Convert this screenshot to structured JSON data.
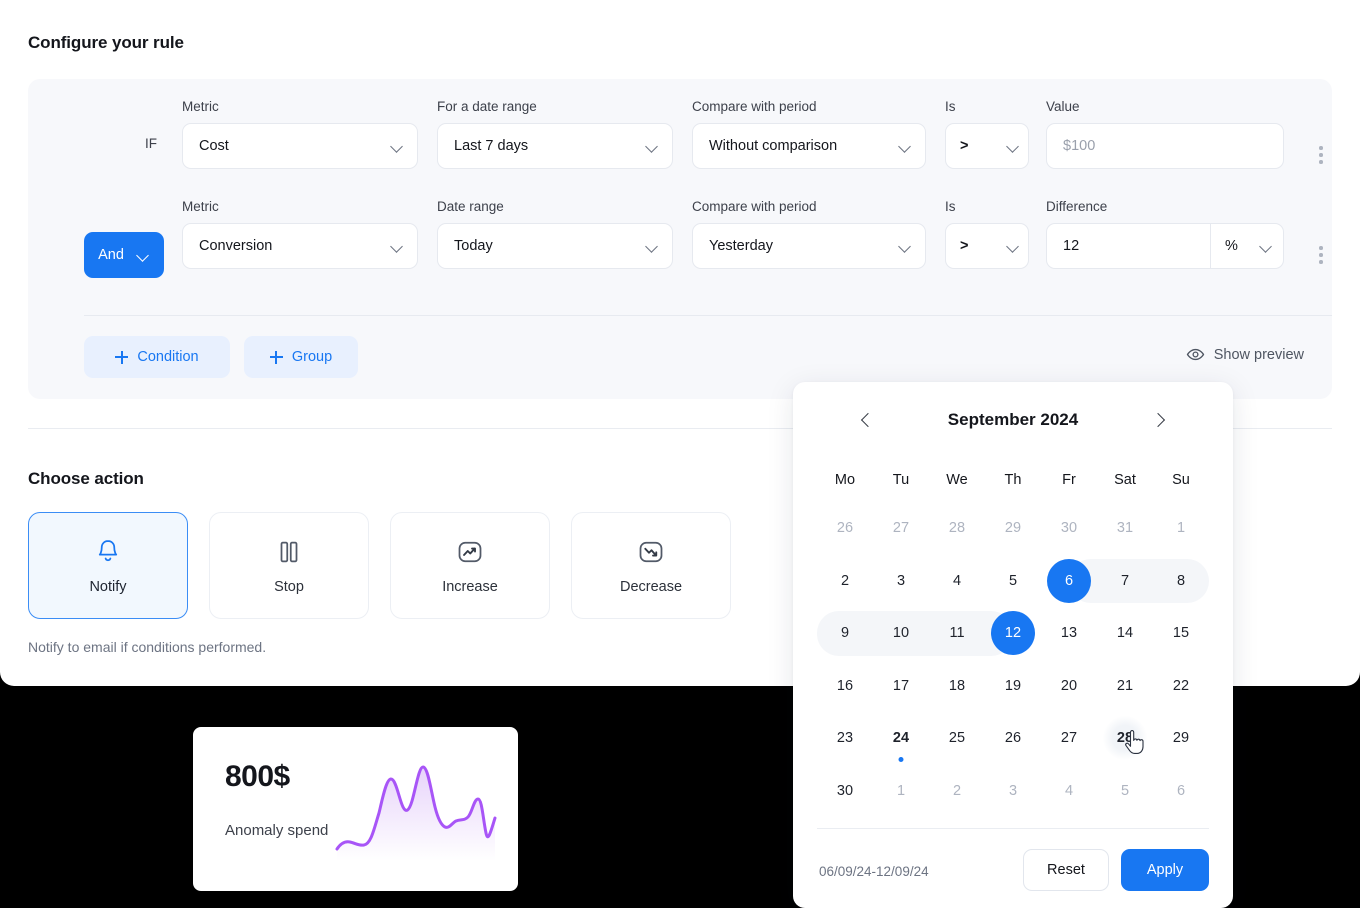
{
  "rule": {
    "title": "Configure your rule",
    "if_label": "IF",
    "and_label": "And",
    "row1": {
      "metric_label": "Metric",
      "metric_value": "Cost",
      "daterange_label": "For a date range",
      "daterange_value": "Last 7 days",
      "compare_label": "Compare with period",
      "compare_value": "Without comparison",
      "is_label": "Is",
      "is_value": ">",
      "value_label": "Value",
      "value_placeholder": "$100"
    },
    "row2": {
      "metric_label": "Metric",
      "metric_value": "Conversion",
      "daterange_label": "Date range",
      "daterange_value": "Today",
      "compare_label": "Compare with period",
      "compare_value": "Yesterday",
      "is_label": "Is",
      "is_value": ">",
      "value_label": "Difference",
      "value_value": "12",
      "unit_value": "%"
    },
    "add_condition": "Condition",
    "add_group": "Group",
    "show_preview": "Show preview"
  },
  "action": {
    "title": "Choose action",
    "cards": [
      {
        "label": "Notify",
        "icon": "bell-icon",
        "selected": true
      },
      {
        "label": "Stop",
        "icon": "pause-icon",
        "selected": false
      },
      {
        "label": "Increase",
        "icon": "trending-up-icon",
        "selected": false
      },
      {
        "label": "Decrease",
        "icon": "trending-down-icon",
        "selected": false
      }
    ],
    "description": "Notify to email if conditions performed."
  },
  "anomaly": {
    "amount": "800$",
    "label": "Anomaly spend",
    "line_color": "#9b4ee0"
  },
  "calendar": {
    "month": "September 2024",
    "weekdays": [
      "Mo",
      "Tu",
      "We",
      "Th",
      "Fr",
      "Sat",
      "Su"
    ],
    "range_text": "06/09/24-12/09/24",
    "reset_label": "Reset",
    "apply_label": "Apply",
    "accent": "#1877f2",
    "weeks": [
      [
        {
          "d": "26",
          "muted": true
        },
        {
          "d": "27",
          "muted": true
        },
        {
          "d": "28",
          "muted": true
        },
        {
          "d": "29",
          "muted": true
        },
        {
          "d": "30",
          "muted": true
        },
        {
          "d": "31",
          "muted": true
        },
        {
          "d": "1",
          "muted": true
        }
      ],
      [
        {
          "d": "2"
        },
        {
          "d": "3"
        },
        {
          "d": "4"
        },
        {
          "d": "5"
        },
        {
          "d": "6",
          "selected": true,
          "rangeStart": true
        },
        {
          "d": "7",
          "inrange": true
        },
        {
          "d": "8",
          "inrange": true,
          "rowend": true
        }
      ],
      [
        {
          "d": "9",
          "inrange": true,
          "rowstart": true
        },
        {
          "d": "10",
          "inrange": true
        },
        {
          "d": "11",
          "inrange": true
        },
        {
          "d": "12",
          "selected": true,
          "rangeEnd": true
        },
        {
          "d": "13"
        },
        {
          "d": "14"
        },
        {
          "d": "15"
        }
      ],
      [
        {
          "d": "16"
        },
        {
          "d": "17"
        },
        {
          "d": "18"
        },
        {
          "d": "19"
        },
        {
          "d": "20"
        },
        {
          "d": "21"
        },
        {
          "d": "22"
        }
      ],
      [
        {
          "d": "23"
        },
        {
          "d": "24",
          "today": true,
          "dot": true
        },
        {
          "d": "25"
        },
        {
          "d": "26"
        },
        {
          "d": "27"
        },
        {
          "d": "28",
          "hovered": true,
          "cursor": true
        },
        {
          "d": "29"
        }
      ],
      [
        {
          "d": "30"
        },
        {
          "d": "1",
          "muted": true
        },
        {
          "d": "2",
          "muted": true
        },
        {
          "d": "3",
          "muted": true
        },
        {
          "d": "4",
          "muted": true
        },
        {
          "d": "5",
          "muted": true
        },
        {
          "d": "6",
          "muted": true
        }
      ]
    ]
  }
}
